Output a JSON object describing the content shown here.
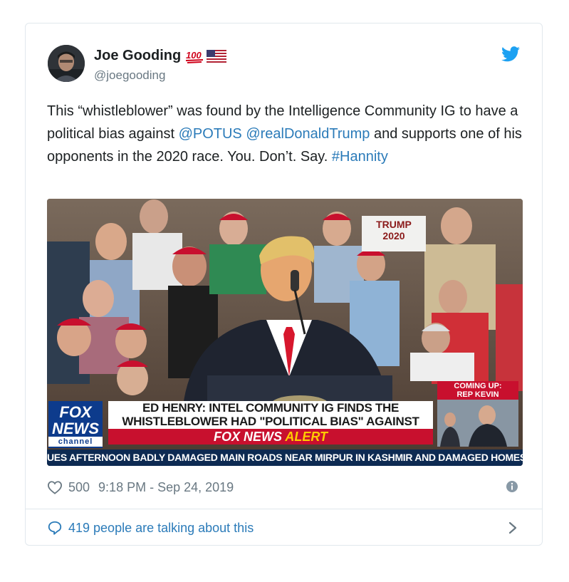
{
  "tweet": {
    "author_name": "Joe Gooding",
    "name_badge": "100",
    "handle": "@joegooding",
    "text_parts": {
      "p1": "This “whistleblower” was found by the Intelligence Community IG to have a political bias against ",
      "mention1": "@POTUS",
      "space": " ",
      "mention2": "@realDonaldTrump",
      "p2": " and supports one of his opponents in the 2020 race. You. Don’t. Say. ",
      "hashtag": "#Hannity"
    },
    "likes": "500",
    "time": "9:18 PM - Sep 24, 2019",
    "talking": "419 people are talking about this"
  },
  "media": {
    "sign_text_1": "TRUMP",
    "sign_text_2": "2020",
    "coming_up_1": "COMING UP:",
    "coming_up_2": "REP KEVIN MCCARTHY",
    "headline_1": "ED HENRY: INTEL COMMUNITY IG FINDS THE",
    "headline_2": "WHISTLEBLOWER HAD \"POLITICAL BIAS\" AGAINST TRUMP",
    "alert_brand": "FOX NEWS",
    "alert_word": "ALERT",
    "logo_line1": "FOX",
    "logo_line2": "NEWS",
    "logo_line3": "channel",
    "ticker": "UES AFTERNOON BADLY DAMAGED MAIN ROADS NEAR MIRPUR IN KASHMIR AND DAMAGED HOMES AND"
  },
  "colors": {
    "link": "#2b7bb9",
    "meta_gray": "#697882",
    "twitter_blue": "#1da1f2",
    "fox_red": "#c8102e",
    "fox_blue": "#0d3b8c"
  },
  "icons": [
    "twitter-bird-icon",
    "heart-icon",
    "info-icon",
    "speech-bubble-icon",
    "chevron-right-icon",
    "hundred-emoji-icon",
    "us-flag-icon"
  ]
}
